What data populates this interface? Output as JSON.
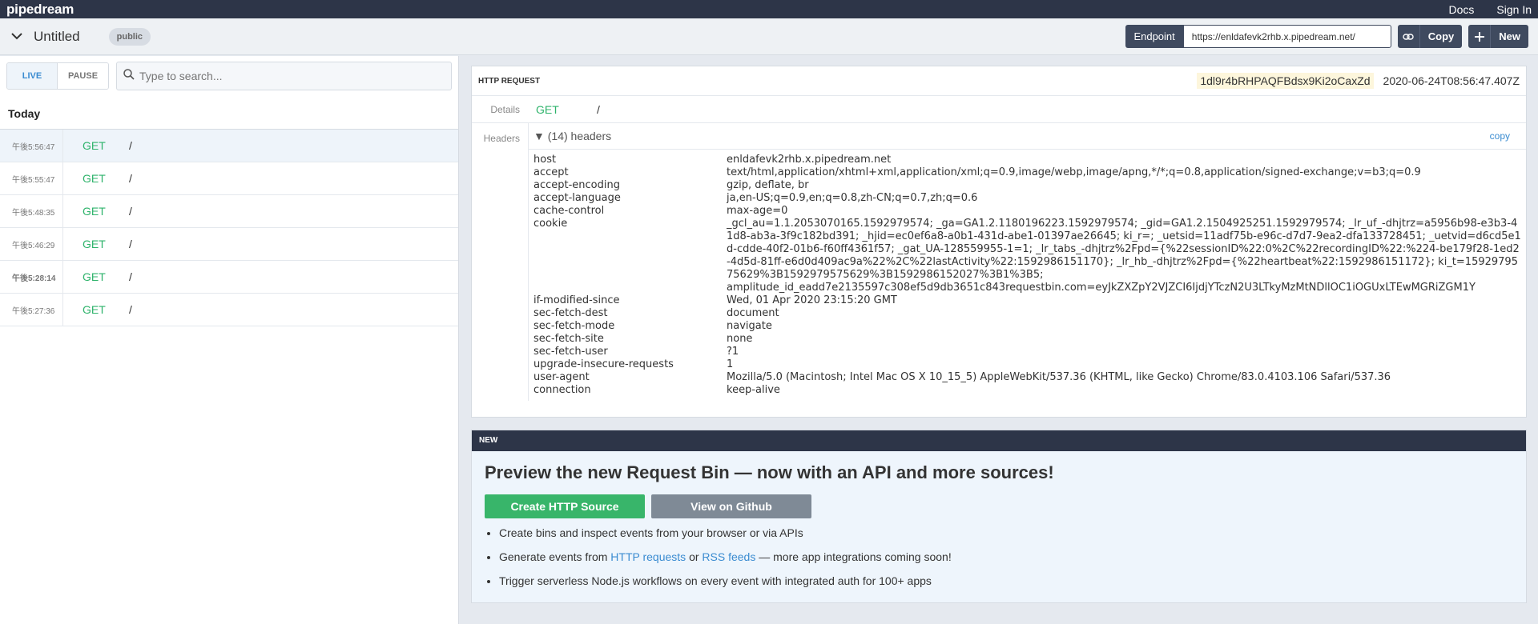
{
  "topbar": {
    "logo": "pipedream",
    "docs": "Docs",
    "sign_in": "Sign In"
  },
  "subbar": {
    "title": "Untitled",
    "visibility": "public",
    "endpoint_label": "Endpoint",
    "endpoint_url": "https://enldafevk2rhb.x.pipedream.net/",
    "copy_label": "Copy",
    "new_label": "New"
  },
  "sidebar": {
    "live_label": "LIVE",
    "pause_label": "PAUSE",
    "search_placeholder": "Type to search...",
    "day_heading": "Today",
    "events": [
      {
        "time": "午後5:56:47",
        "method": "GET",
        "path": "/"
      },
      {
        "time": "午後5:55:47",
        "method": "GET",
        "path": "/"
      },
      {
        "time": "午後5:48:35",
        "method": "GET",
        "path": "/"
      },
      {
        "time": "午後5:46:29",
        "method": "GET",
        "path": "/"
      },
      {
        "time": "午後5:28:14",
        "method": "GET",
        "path": "/"
      },
      {
        "time": "午後5:27:36",
        "method": "GET",
        "path": "/"
      }
    ]
  },
  "request": {
    "section_label": "HTTP REQUEST",
    "request_id": "1dl9r4bRHPAQFBdsx9Ki2oCaxZd",
    "timestamp": "2020-06-24T08:56:47.407Z",
    "details_label": "Details",
    "method": "GET",
    "path": "/",
    "headers_label": "Headers",
    "headers_toggle": "▼ (14) headers",
    "headers_copy": "copy",
    "headers": [
      {
        "k": "host",
        "v": "enldafevk2rhb.x.pipedream.net"
      },
      {
        "k": "accept",
        "v": "text/html,application/xhtml+xml,application/xml;q=0.9,image/webp,image/apng,*/*;q=0.8,application/signed-exchange;v=b3;q=0.9"
      },
      {
        "k": "accept-encoding",
        "v": "gzip, deflate, br"
      },
      {
        "k": "accept-language",
        "v": "ja,en-US;q=0.9,en;q=0.8,zh-CN;q=0.7,zh;q=0.6"
      },
      {
        "k": "cache-control",
        "v": "max-age=0"
      },
      {
        "k": "cookie",
        "v": "_gcl_au=1.1.2053070165.1592979574; _ga=GA1.2.1180196223.1592979574; _gid=GA1.2.1504925251.1592979574; _lr_uf_-dhjtrz=a5956b98-e3b3-41d8-ab3a-3f9c182bd391; _hjid=ec0ef6a8-a0b1-431d-abe1-01397ae26645; ki_r=; _uetsid=11adf75b-e96c-d7d7-9ea2-dfa133728451; _uetvid=d6cd5e1d-cdde-40f2-01b6-f60ff4361f57; _gat_UA-128559955-1=1; _lr_tabs_-dhjtrz%2Fpd={%22sessionID%22:0%2C%22recordingID%22:%224-be179f28-1ed2-4d5d-81ff-e6d0d409ac9a%22%2C%22lastActivity%22:1592986151170}; _lr_hb_-dhjtrz%2Fpd={%22heartbeat%22:1592986151172}; ki_t=1592979575629%3B1592979575629%3B1592986152027%3B1%3B5;",
        "tail": "amplitude_id_eadd7e2135597c308ef5d9db3651c843requestbin.com=eyJkZXZpY2VJZCI6IjdjYTczN2U3LTkyMzMtNDllOC1iOGUxLTEwMGRiZGM1Y"
      },
      {
        "k": "if-modified-since",
        "v": "Wed, 01 Apr 2020 23:15:20 GMT"
      },
      {
        "k": "sec-fetch-dest",
        "v": "document"
      },
      {
        "k": "sec-fetch-mode",
        "v": "navigate"
      },
      {
        "k": "sec-fetch-site",
        "v": "none"
      },
      {
        "k": "sec-fetch-user",
        "v": "?1"
      },
      {
        "k": "upgrade-insecure-requests",
        "v": "1"
      },
      {
        "k": "user-agent",
        "v": "Mozilla/5.0 (Macintosh; Intel Mac OS X 10_15_5) AppleWebKit/537.36 (KHTML, like Gecko) Chrome/83.0.4103.106 Safari/537.36"
      },
      {
        "k": "connection",
        "v": "keep-alive"
      }
    ]
  },
  "promo": {
    "badge": "NEW",
    "title": "Preview the new Request Bin — now with an API and more sources!",
    "create_btn": "Create HTTP Source",
    "github_btn": "View on Github",
    "b1": "Create bins and inspect events from your browser or via APIs",
    "b2_pre": "Generate events from ",
    "b2_link1": "HTTP requests",
    "b2_mid": " or ",
    "b2_link2": "RSS feeds",
    "b2_post": " — more app integrations coming soon!",
    "b3": "Trigger serverless Node.js workflows on every event with integrated auth for 100+ apps"
  },
  "colors": {
    "navy": "#2d3548",
    "method_green": "#2eb36b",
    "link_blue": "#3b8cd1",
    "id_highlight": "#fdf6dc"
  }
}
